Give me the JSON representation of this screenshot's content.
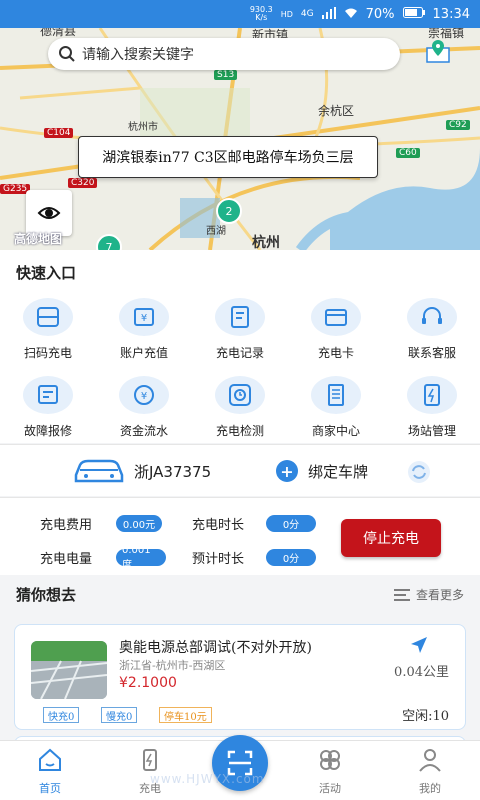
{
  "status_bar": {
    "speed_value": "930.3",
    "speed_unit": "K/s",
    "hd": "HD",
    "network": "4G",
    "battery": "70%",
    "time": "13:34"
  },
  "map": {
    "search_placeholder": "请输入搜索关键字",
    "tooltip": "湖滨银泰in77 C3区邮电路停车场负三层",
    "logo_text": "高德地图",
    "place_labels": [
      "德清县",
      "新市镇",
      "崇福镇",
      "余杭区",
      "杭州市",
      "西湖",
      "杭州"
    ],
    "road_badges": [
      "S13",
      "C104",
      "C92",
      "C60",
      "C320",
      "G235"
    ],
    "clusters": [
      "2",
      "7"
    ]
  },
  "quick_entry": {
    "title": "快速入口",
    "items": [
      {
        "label": "扫码充电",
        "icon": "scan-icon"
      },
      {
        "label": "账户充值",
        "icon": "wallet-icon"
      },
      {
        "label": "充电记录",
        "icon": "record-icon"
      },
      {
        "label": "充电卡",
        "icon": "card-icon"
      },
      {
        "label": "联系客服",
        "icon": "headset-icon"
      },
      {
        "label": "故障报修",
        "icon": "repair-icon"
      },
      {
        "label": "资金流水",
        "icon": "money-flow-icon"
      },
      {
        "label": "充电检测",
        "icon": "clock-icon"
      },
      {
        "label": "商家中心",
        "icon": "merchant-icon"
      },
      {
        "label": "场站管理",
        "icon": "station-icon"
      }
    ]
  },
  "plate": {
    "number": "浙JA37375",
    "bind_label": "绑定车牌"
  },
  "charging": {
    "fee_label": "充电费用",
    "fee_value": "0.00元",
    "duration_label": "充电时长",
    "duration_value": "0分",
    "energy_label": "充电电量",
    "energy_value": "0.001度",
    "estimate_label": "预计时长",
    "estimate_value": "0分",
    "stop_label": "停止充电"
  },
  "guess": {
    "title": "猜你想去",
    "more_label": "查看更多",
    "card": {
      "title": "奥能电源总部调试(不对外开放)",
      "address": "浙江省-杭州市-西湖区",
      "price": "¥2.1000",
      "distance": "0.04公里",
      "fast": "快充0",
      "slow": "慢充0",
      "parking": "停车10元",
      "free": "空闲:10"
    }
  },
  "tabbar": {
    "tabs": [
      {
        "label": "首页"
      },
      {
        "label": "充电"
      },
      {
        "label": "活动"
      },
      {
        "label": "我的"
      }
    ]
  },
  "watermark": "www.HJWYX.com",
  "colors": {
    "primary": "#2f86df",
    "stop": "#c4141b",
    "price": "#d3262c"
  }
}
